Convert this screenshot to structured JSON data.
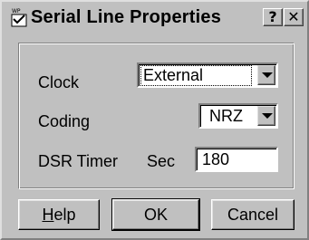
{
  "window": {
    "title": "Serial Line Properties",
    "help_glyph": "?",
    "close_glyph": "✕"
  },
  "form": {
    "clock": {
      "label": "Clock",
      "value": "External"
    },
    "coding": {
      "label": "Coding",
      "value": "NRZ"
    },
    "dsr_timer": {
      "label": "DSR Timer",
      "unit": "Sec",
      "value": "180"
    }
  },
  "buttons": {
    "help": {
      "mnemonic": "H",
      "rest": "elp"
    },
    "ok": "OK",
    "cancel": "Cancel"
  },
  "icons": {
    "app": "serial-app-icon",
    "dropdown": "chevron-down-icon"
  },
  "colors": {
    "face": "#c0c0c0",
    "highlight": "#ffffff",
    "shadow": "#808080"
  }
}
